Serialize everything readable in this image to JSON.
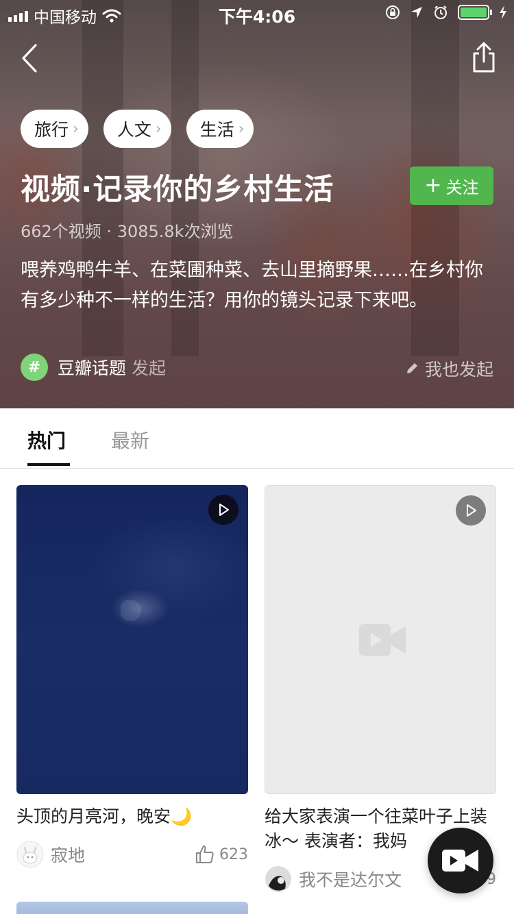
{
  "status_bar": {
    "carrier": "中国移动",
    "time": "下午4:06",
    "icons": [
      "signal-icon",
      "wifi-icon",
      "rotation-lock-icon",
      "location-icon",
      "alarm-icon",
      "battery-icon",
      "charging-icon"
    ]
  },
  "nav": {
    "back_icon": "back-arrow-icon",
    "share_icon": "share-icon"
  },
  "topic": {
    "tags": [
      {
        "label": "旅行"
      },
      {
        "label": "人文"
      },
      {
        "label": "生活"
      }
    ],
    "title": "视频·记录你的乡村生活",
    "follow_label": "关注",
    "stats": "662个视频 · 3085.8k次浏览",
    "description": "喂养鸡鸭牛羊、在菜圃种菜、去山里摘野果……在乡村你有多少种不一样的生活？用你的镜头记录下来吧。",
    "origin_badge": "#",
    "origin_name": "豆瓣话题",
    "origin_suffix": "发起",
    "also_start_label": "我也发起"
  },
  "tabs": [
    {
      "label": "热门",
      "active": true
    },
    {
      "label": "最新",
      "active": false
    }
  ],
  "cards": [
    {
      "title": "头顶的月亮河，晚安🌙",
      "author": "寂地",
      "likes": "623"
    },
    {
      "title": "给大家表演一个往菜叶子上装冰～ 表演者：我妈",
      "author": "我不是达尔文",
      "likes": "9"
    }
  ],
  "colors": {
    "accent_green": "#52b64e",
    "fab_dark": "#1b1b1b",
    "battery_green": "#5dd36a"
  }
}
